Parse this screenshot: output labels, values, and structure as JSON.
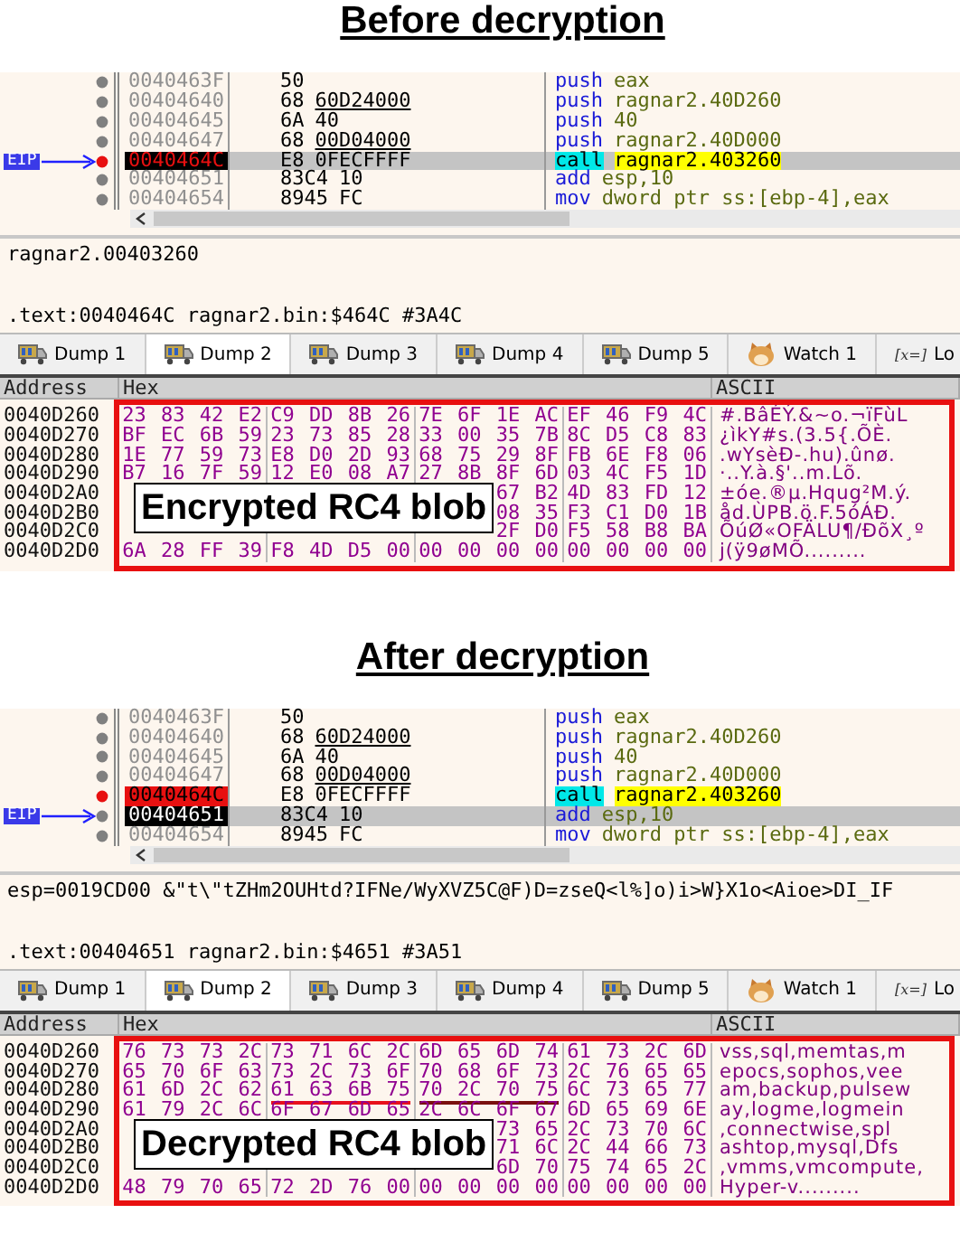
{
  "sections": [
    {
      "heading": "Before decryption",
      "disassembly": {
        "eip_label": "EIP",
        "rows": [
          {
            "address": "0040463F",
            "opcode": "50",
            "mnemonic": "push",
            "operands": "eax",
            "kind": "plain",
            "breakpoint": false,
            "current": false
          },
          {
            "address": "00404640",
            "opcode": "68",
            "operand_bytes": "60D24000",
            "linked": true,
            "mnemonic": "push",
            "operands": "ragnar2.40D260",
            "kind": "plain",
            "breakpoint": false,
            "current": false
          },
          {
            "address": "00404645",
            "opcode": "6A",
            "operand_bytes": "40",
            "linked": false,
            "mnemonic": "push",
            "operands": "40",
            "kind": "plain",
            "breakpoint": false,
            "current": false
          },
          {
            "address": "00404647",
            "opcode": "68",
            "operand_bytes": "00D04000",
            "linked": true,
            "mnemonic": "push",
            "operands": "ragnar2.40D000",
            "kind": "plain",
            "breakpoint": false,
            "current": false
          },
          {
            "address": "0040464C",
            "opcode": "E8",
            "operand_bytes": "0FECFFFF",
            "linked": false,
            "mnemonic": "call",
            "operands": "ragnar2.403260",
            "kind": "call",
            "breakpoint": true,
            "current": true
          },
          {
            "address": "00404651",
            "opcode": "83C4",
            "operand_bytes": "10",
            "linked": false,
            "mnemonic": "add",
            "operands": "esp,10",
            "kind": "plain",
            "breakpoint": false,
            "current": false
          },
          {
            "address": "00404654",
            "opcode": "8945",
            "operand_bytes": "FC",
            "linked": false,
            "mnemonic": "mov",
            "operands": "dword ptr ss:[ebp-4],eax",
            "kind": "plain",
            "breakpoint": false,
            "current": false
          }
        ]
      },
      "info": [
        "ragnar2.00403260",
        ".text:0040464C ragnar2.bin:$464C #3A4C"
      ],
      "tabs": [
        {
          "label": "Dump 1",
          "kind": "dump",
          "selected": false
        },
        {
          "label": "Dump 2",
          "kind": "dump",
          "selected": true
        },
        {
          "label": "Dump 3",
          "kind": "dump",
          "selected": false
        },
        {
          "label": "Dump 4",
          "kind": "dump",
          "selected": false
        },
        {
          "label": "Dump 5",
          "kind": "dump",
          "selected": false
        },
        {
          "label": "Watch 1",
          "kind": "watch",
          "selected": false
        },
        {
          "label": "Lo",
          "kind": "locals",
          "glyph": "[x=]",
          "selected": false
        }
      ],
      "dump": {
        "columns": [
          "Address",
          "Hex",
          "ASCII"
        ],
        "callout": "Encrypted RC4 blob",
        "rows": [
          {
            "address": "0040D260",
            "groups": [
              {
                "bytes": "23 83 42 E2"
              },
              {
                "bytes": "C9 DD 8B 26"
              },
              {
                "bytes": "7E 6F 1E AC"
              },
              {
                "bytes": "EF 46 F9 4C"
              }
            ],
            "ascii": "#.BâÉÝ.&~o.¬ïFùL"
          },
          {
            "address": "0040D270",
            "groups": [
              {
                "bytes": "BF EC 6B 59"
              },
              {
                "bytes": "23 73 85 28"
              },
              {
                "bytes": "33 00 35 7B"
              },
              {
                "bytes": "8C D5 C8 83"
              }
            ],
            "ascii": "¿ìkY#s.(3.5{.ÕÈ."
          },
          {
            "address": "0040D280",
            "groups": [
              {
                "bytes": "1E 77 59 73"
              },
              {
                "bytes": "E8 D0 2D 93"
              },
              {
                "bytes": "68 75 29 8F"
              },
              {
                "bytes": "FB 6E F8 06"
              }
            ],
            "ascii": ".wYsèÐ-.hu).ûnø."
          },
          {
            "address": "0040D290",
            "groups": [
              {
                "bytes": "B7 16 7F 59"
              },
              {
                "bytes": "12 E0 08 A7"
              },
              {
                "bytes": "27 8B 8F 6D"
              },
              {
                "bytes": "03 4C F5 1D"
              }
            ],
            "ascii": "·..Y.à.§'..m.Lõ."
          },
          {
            "address": "0040D2A0",
            "groups": [
              {
                "bytes": "67 B2"
              },
              {
                "bytes": "4D 83 FD 12"
              }
            ],
            "ascii": "±óe.®µ.Hqug²M.ý."
          },
          {
            "address": "0040D2B0",
            "groups": [
              {
                "bytes": "08 35"
              },
              {
                "bytes": "F3 C1 D0 1B"
              }
            ],
            "ascii": "åd.ÙPB.ö.F.5óÁÐ."
          },
          {
            "address": "0040D2C0",
            "groups": [
              {
                "bytes": "2F D0"
              },
              {
                "bytes": "F5 58 B8 BA"
              }
            ],
            "ascii": "ÕúØ«OFÄLU¶/ÐõX¸º"
          },
          {
            "address": "0040D2D0",
            "groups": [
              {
                "bytes": "6A 28 FF 39"
              },
              {
                "bytes": "F8 4D D5 00"
              },
              {
                "bytes": "00 00 00 00"
              },
              {
                "bytes": "00 00 00 00"
              }
            ],
            "ascii": "j(ÿ9øMÕ........."
          }
        ]
      }
    },
    {
      "heading": "After decryption",
      "disassembly": {
        "eip_label": "EIP",
        "rows": [
          {
            "address": "0040463F",
            "opcode": "50",
            "mnemonic": "push",
            "operands": "eax",
            "kind": "plain",
            "breakpoint": false,
            "current": false
          },
          {
            "address": "00404640",
            "opcode": "68",
            "operand_bytes": "60D24000",
            "linked": true,
            "mnemonic": "push",
            "operands": "ragnar2.40D260",
            "kind": "plain",
            "breakpoint": false,
            "current": false
          },
          {
            "address": "00404645",
            "opcode": "6A",
            "operand_bytes": "40",
            "linked": false,
            "mnemonic": "push",
            "operands": "40",
            "kind": "plain",
            "breakpoint": false,
            "current": false
          },
          {
            "address": "00404647",
            "opcode": "68",
            "operand_bytes": "00D04000",
            "linked": true,
            "mnemonic": "push",
            "operands": "ragnar2.40D000",
            "kind": "plain",
            "breakpoint": false,
            "current": false
          },
          {
            "address": "0040464C",
            "opcode": "E8",
            "operand_bytes": "0FECFFFF",
            "linked": false,
            "mnemonic": "call",
            "operands": "ragnar2.403260",
            "kind": "call",
            "breakpoint": true,
            "current": false
          },
          {
            "address": "00404651",
            "opcode": "83C4",
            "operand_bytes": "10",
            "linked": false,
            "mnemonic": "add",
            "operands": "esp,10",
            "kind": "plain",
            "breakpoint": false,
            "current": true
          },
          {
            "address": "00404654",
            "opcode": "8945",
            "operand_bytes": "FC",
            "linked": false,
            "mnemonic": "mov",
            "operands": "dword ptr ss:[ebp-4],eax",
            "kind": "plain",
            "breakpoint": false,
            "current": false
          }
        ]
      },
      "info": [
        "esp=0019CD00 &\"t\\\"tZHm2OUHtd?IFNe/WyXVZ5C@F)D=zseQ<l%]o)i>W}X1o<Aioe>DI_IF",
        ".text:00404651 ragnar2.bin:$4651 #3A51"
      ],
      "tabs": [
        {
          "label": "Dump 1",
          "kind": "dump",
          "selected": false
        },
        {
          "label": "Dump 2",
          "kind": "dump",
          "selected": true
        },
        {
          "label": "Dump 3",
          "kind": "dump",
          "selected": false
        },
        {
          "label": "Dump 4",
          "kind": "dump",
          "selected": false
        },
        {
          "label": "Dump 5",
          "kind": "dump",
          "selected": false
        },
        {
          "label": "Watch 1",
          "kind": "watch",
          "selected": false
        },
        {
          "label": "Lo",
          "kind": "locals",
          "glyph": "[x=]",
          "selected": false
        }
      ],
      "dump": {
        "columns": [
          "Address",
          "Hex",
          "ASCII"
        ],
        "callout": "Decrypted RC4 blob",
        "rows": [
          {
            "address": "0040D260",
            "groups": [
              {
                "bytes": "76 73 73 2C"
              },
              {
                "bytes": "73 71 6C 2C"
              },
              {
                "bytes": "6D 65 6D 74"
              },
              {
                "bytes": "61 73 2C 6D"
              }
            ],
            "ascii": "vss,sql,memtas,m"
          },
          {
            "address": "0040D270",
            "groups": [
              {
                "bytes": "65 70 6F 63"
              },
              {
                "bytes": "73 2C 73 6F"
              },
              {
                "bytes": "70 68 6F 73"
              },
              {
                "bytes": "2C 76 65 65"
              }
            ],
            "ascii": "epocs,sophos,vee"
          },
          {
            "address": "0040D280",
            "groups": [
              {
                "bytes": "61 6D 2C 62"
              },
              {
                "bytes": "61 63 6B 75",
                "color": "#e8101c"
              },
              {
                "bytes": "70 2C 70 75",
                "color": "#7a1010"
              },
              {
                "bytes": "6C 73 65 77"
              }
            ],
            "ascii": "am,backup,pulsew"
          },
          {
            "address": "0040D290",
            "groups": [
              {
                "bytes": "61 79 2C 6C"
              },
              {
                "bytes": "6F 67 6D 65"
              },
              {
                "bytes": "2C 6C 6F 67"
              },
              {
                "bytes": "6D 65 69 6E"
              }
            ],
            "ascii": "ay,logme,logmein"
          },
          {
            "address": "0040D2A0",
            "groups": [
              {
                "bytes": "73 65"
              },
              {
                "bytes": "2C 73 70 6C"
              }
            ],
            "ascii": ",connectwise,spl"
          },
          {
            "address": "0040D2B0",
            "groups": [
              {
                "bytes": "71 6C"
              },
              {
                "bytes": "2C 44 66 73"
              }
            ],
            "ascii": "ashtop,mysql,Dfs"
          },
          {
            "address": "0040D2C0",
            "groups": [
              {
                "bytes": "6D 70"
              },
              {
                "bytes": "75 74 65 2C"
              }
            ],
            "ascii": ",vmms,vmcompute,"
          },
          {
            "address": "0040D2D0",
            "groups": [
              {
                "bytes": "48 79 70 65"
              },
              {
                "bytes": "72 2D 76 00"
              },
              {
                "bytes": "00 00 00 00"
              },
              {
                "bytes": "00 00 00 00"
              }
            ],
            "ascii": "Hyper-v........."
          }
        ]
      }
    }
  ]
}
